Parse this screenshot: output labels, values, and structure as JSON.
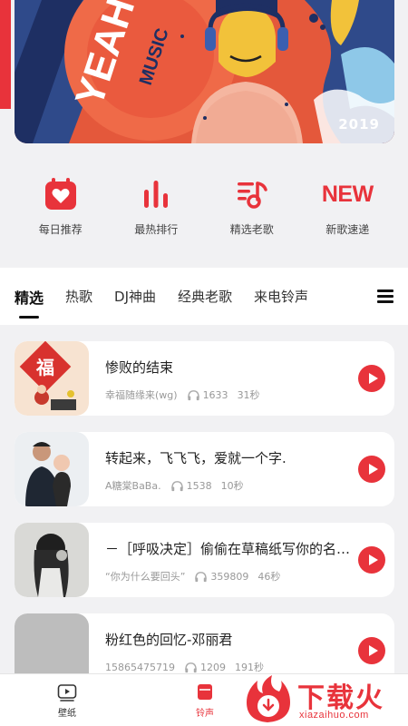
{
  "banner": {
    "year": "2019"
  },
  "quick_nav": [
    {
      "label": "每日推荐",
      "icon": "calendar-heart-icon"
    },
    {
      "label": "最热排行",
      "icon": "bar-chart-icon"
    },
    {
      "label": "精选老歌",
      "icon": "music-list-icon"
    },
    {
      "label": "新歌速递",
      "icon": "new-badge-icon",
      "badge_text": "NEW"
    }
  ],
  "tabs": [
    {
      "label": "精选",
      "active": true
    },
    {
      "label": "热歌"
    },
    {
      "label": "DJ神曲"
    },
    {
      "label": "经典老歌"
    },
    {
      "label": "来电铃声"
    }
  ],
  "songs": [
    {
      "title": "惨败的结束",
      "author": "幸福随缘来(wg)",
      "plays": "1633",
      "duration": "31秒"
    },
    {
      "title": "转起来，飞飞飞，爱就一个字.",
      "author": "A糖棠BaBa.",
      "plays": "1538",
      "duration": "10秒"
    },
    {
      "title": "－［呼吸决定］偷偷在草稿纸写你的名字...",
      "author": "“你为什么要回头”",
      "plays": "359809",
      "duration": "46秒"
    },
    {
      "title": "粉红色的回忆-邓丽君",
      "author": "15865475719",
      "plays": "1209",
      "duration": "191秒"
    }
  ],
  "bottom_nav": [
    {
      "label": "壁纸",
      "icon": "video-icon"
    },
    {
      "label": "铃声",
      "icon": "bell-icon",
      "active": true
    }
  ],
  "watermark": {
    "text": "下载火",
    "url": "xiazaihuo.com"
  },
  "colors": {
    "accent": "#e8333b",
    "background": "#f1f1f3"
  }
}
